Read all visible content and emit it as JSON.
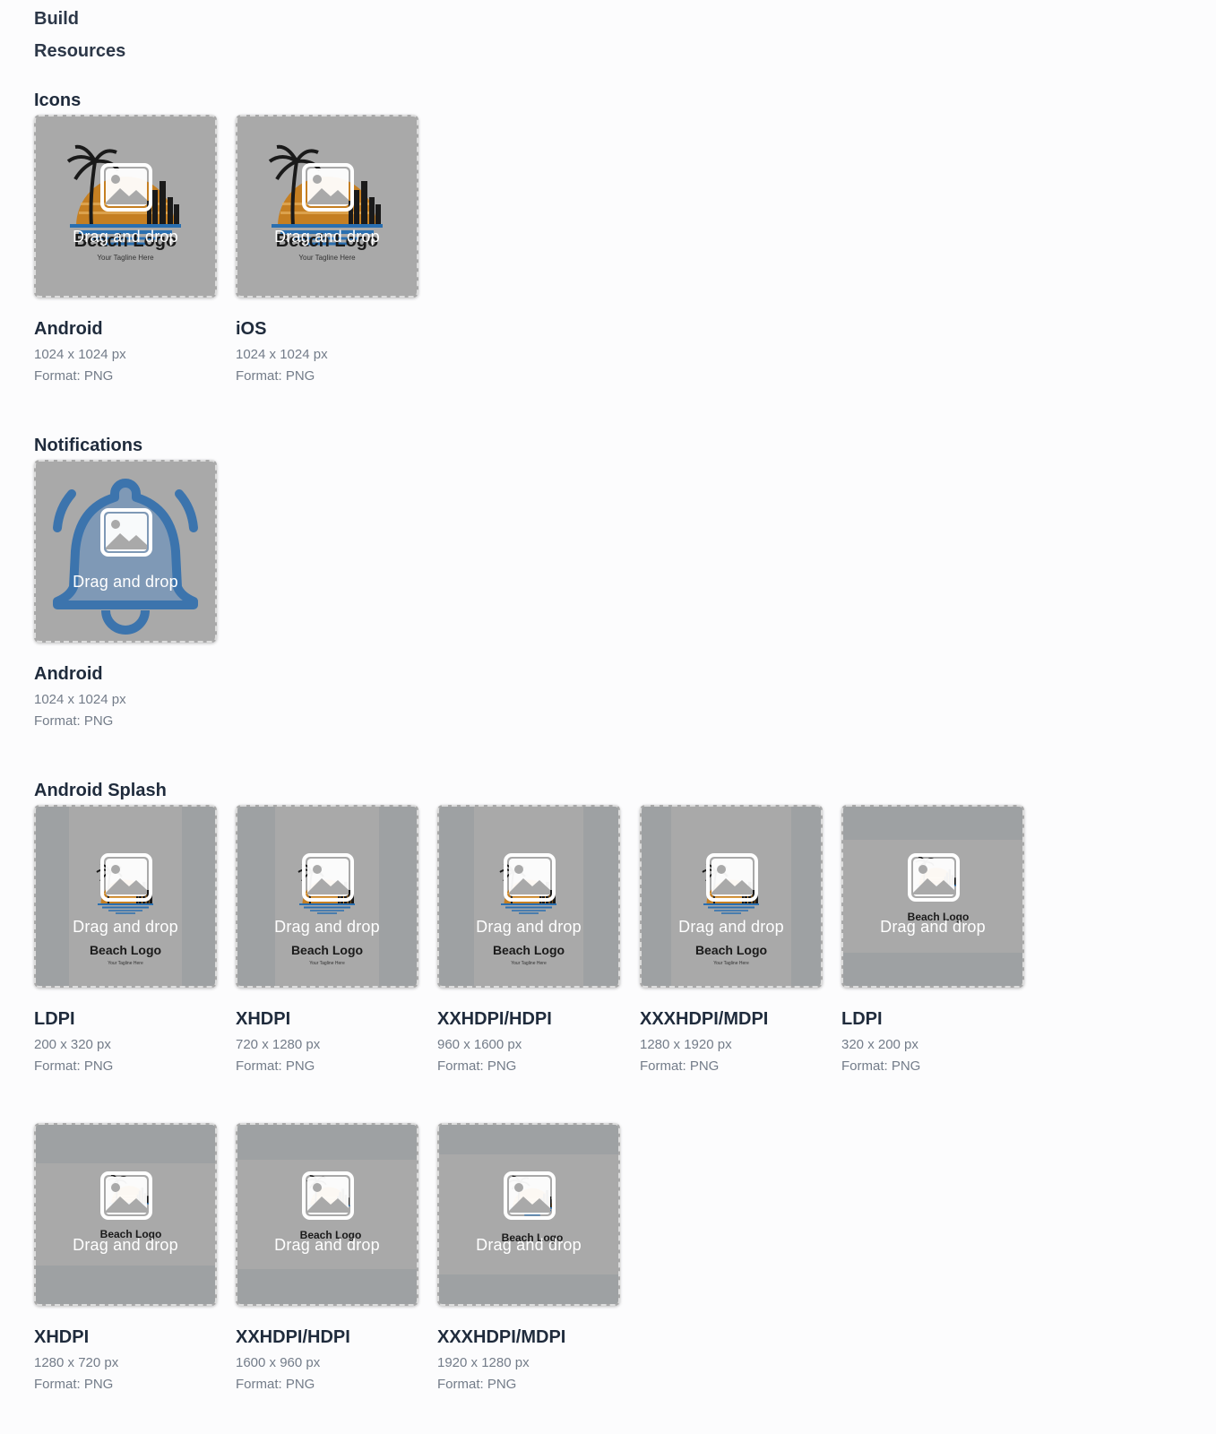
{
  "nav": {
    "build": "Build",
    "resources": "Resources"
  },
  "sections": {
    "icons": "Icons",
    "notifications": "Notifications",
    "android_splash": "Android Splash"
  },
  "drop_label": "Drag and drop",
  "logo": {
    "name": "Beach Logo",
    "tagline": "Your Tagline Here"
  },
  "colors": {
    "tile_bg": "#a9a9a9",
    "splash_bar": "#9ea1a3",
    "sun": "#c57f22",
    "water": "#2a6fb0",
    "bell": "#3c74ad"
  },
  "icons": [
    {
      "name": "Android",
      "size": "1024 x 1024 px",
      "format": "Format: PNG",
      "preview": "beach-logo"
    },
    {
      "name": "iOS",
      "size": "1024 x 1024 px",
      "format": "Format: PNG",
      "preview": "beach-logo"
    }
  ],
  "notifications": [
    {
      "name": "Android",
      "size": "1024 x 1024 px",
      "format": "Format: PNG",
      "preview": "bell-icon"
    }
  ],
  "splash": [
    {
      "name": "LDPI",
      "size": "200 x 320 px",
      "format": "Format: PNG",
      "orientation": "portrait"
    },
    {
      "name": "XHDPI",
      "size": "720 x 1280 px",
      "format": "Format: PNG",
      "orientation": "portrait"
    },
    {
      "name": "XXHDPI/HDPI",
      "size": "960 x 1600 px",
      "format": "Format: PNG",
      "orientation": "portrait"
    },
    {
      "name": "XXXHDPI/MDPI",
      "size": "1280 x 1920 px",
      "format": "Format: PNG",
      "orientation": "portrait"
    },
    {
      "name": "LDPI",
      "size": "320 x 200 px",
      "format": "Format: PNG",
      "orientation": "landscape"
    },
    {
      "name": "XHDPI",
      "size": "1280 x 720 px",
      "format": "Format: PNG",
      "orientation": "landscape"
    },
    {
      "name": "XXHDPI/HDPI",
      "size": "1600 x 960 px",
      "format": "Format: PNG",
      "orientation": "landscape"
    },
    {
      "name": "XXXHDPI/MDPI",
      "size": "1920 x 1280 px",
      "format": "Format: PNG",
      "orientation": "landscape"
    }
  ]
}
